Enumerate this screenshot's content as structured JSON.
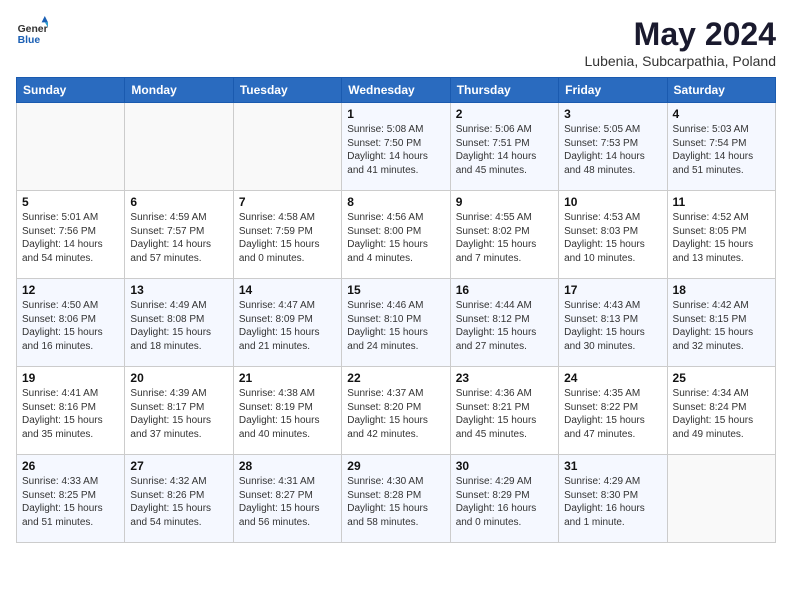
{
  "header": {
    "logo_general": "General",
    "logo_blue": "Blue",
    "title": "May 2024",
    "location": "Lubenia, Subcarpathia, Poland"
  },
  "weekdays": [
    "Sunday",
    "Monday",
    "Tuesday",
    "Wednesday",
    "Thursday",
    "Friday",
    "Saturday"
  ],
  "weeks": [
    [
      {
        "day": "",
        "info": ""
      },
      {
        "day": "",
        "info": ""
      },
      {
        "day": "",
        "info": ""
      },
      {
        "day": "1",
        "info": "Sunrise: 5:08 AM\nSunset: 7:50 PM\nDaylight: 14 hours\nand 41 minutes."
      },
      {
        "day": "2",
        "info": "Sunrise: 5:06 AM\nSunset: 7:51 PM\nDaylight: 14 hours\nand 45 minutes."
      },
      {
        "day": "3",
        "info": "Sunrise: 5:05 AM\nSunset: 7:53 PM\nDaylight: 14 hours\nand 48 minutes."
      },
      {
        "day": "4",
        "info": "Sunrise: 5:03 AM\nSunset: 7:54 PM\nDaylight: 14 hours\nand 51 minutes."
      }
    ],
    [
      {
        "day": "5",
        "info": "Sunrise: 5:01 AM\nSunset: 7:56 PM\nDaylight: 14 hours\nand 54 minutes."
      },
      {
        "day": "6",
        "info": "Sunrise: 4:59 AM\nSunset: 7:57 PM\nDaylight: 14 hours\nand 57 minutes."
      },
      {
        "day": "7",
        "info": "Sunrise: 4:58 AM\nSunset: 7:59 PM\nDaylight: 15 hours\nand 0 minutes."
      },
      {
        "day": "8",
        "info": "Sunrise: 4:56 AM\nSunset: 8:00 PM\nDaylight: 15 hours\nand 4 minutes."
      },
      {
        "day": "9",
        "info": "Sunrise: 4:55 AM\nSunset: 8:02 PM\nDaylight: 15 hours\nand 7 minutes."
      },
      {
        "day": "10",
        "info": "Sunrise: 4:53 AM\nSunset: 8:03 PM\nDaylight: 15 hours\nand 10 minutes."
      },
      {
        "day": "11",
        "info": "Sunrise: 4:52 AM\nSunset: 8:05 PM\nDaylight: 15 hours\nand 13 minutes."
      }
    ],
    [
      {
        "day": "12",
        "info": "Sunrise: 4:50 AM\nSunset: 8:06 PM\nDaylight: 15 hours\nand 16 minutes."
      },
      {
        "day": "13",
        "info": "Sunrise: 4:49 AM\nSunset: 8:08 PM\nDaylight: 15 hours\nand 18 minutes."
      },
      {
        "day": "14",
        "info": "Sunrise: 4:47 AM\nSunset: 8:09 PM\nDaylight: 15 hours\nand 21 minutes."
      },
      {
        "day": "15",
        "info": "Sunrise: 4:46 AM\nSunset: 8:10 PM\nDaylight: 15 hours\nand 24 minutes."
      },
      {
        "day": "16",
        "info": "Sunrise: 4:44 AM\nSunset: 8:12 PM\nDaylight: 15 hours\nand 27 minutes."
      },
      {
        "day": "17",
        "info": "Sunrise: 4:43 AM\nSunset: 8:13 PM\nDaylight: 15 hours\nand 30 minutes."
      },
      {
        "day": "18",
        "info": "Sunrise: 4:42 AM\nSunset: 8:15 PM\nDaylight: 15 hours\nand 32 minutes."
      }
    ],
    [
      {
        "day": "19",
        "info": "Sunrise: 4:41 AM\nSunset: 8:16 PM\nDaylight: 15 hours\nand 35 minutes."
      },
      {
        "day": "20",
        "info": "Sunrise: 4:39 AM\nSunset: 8:17 PM\nDaylight: 15 hours\nand 37 minutes."
      },
      {
        "day": "21",
        "info": "Sunrise: 4:38 AM\nSunset: 8:19 PM\nDaylight: 15 hours\nand 40 minutes."
      },
      {
        "day": "22",
        "info": "Sunrise: 4:37 AM\nSunset: 8:20 PM\nDaylight: 15 hours\nand 42 minutes."
      },
      {
        "day": "23",
        "info": "Sunrise: 4:36 AM\nSunset: 8:21 PM\nDaylight: 15 hours\nand 45 minutes."
      },
      {
        "day": "24",
        "info": "Sunrise: 4:35 AM\nSunset: 8:22 PM\nDaylight: 15 hours\nand 47 minutes."
      },
      {
        "day": "25",
        "info": "Sunrise: 4:34 AM\nSunset: 8:24 PM\nDaylight: 15 hours\nand 49 minutes."
      }
    ],
    [
      {
        "day": "26",
        "info": "Sunrise: 4:33 AM\nSunset: 8:25 PM\nDaylight: 15 hours\nand 51 minutes."
      },
      {
        "day": "27",
        "info": "Sunrise: 4:32 AM\nSunset: 8:26 PM\nDaylight: 15 hours\nand 54 minutes."
      },
      {
        "day": "28",
        "info": "Sunrise: 4:31 AM\nSunset: 8:27 PM\nDaylight: 15 hours\nand 56 minutes."
      },
      {
        "day": "29",
        "info": "Sunrise: 4:30 AM\nSunset: 8:28 PM\nDaylight: 15 hours\nand 58 minutes."
      },
      {
        "day": "30",
        "info": "Sunrise: 4:29 AM\nSunset: 8:29 PM\nDaylight: 16 hours\nand 0 minutes."
      },
      {
        "day": "31",
        "info": "Sunrise: 4:29 AM\nSunset: 8:30 PM\nDaylight: 16 hours\nand 1 minute."
      },
      {
        "day": "",
        "info": ""
      }
    ]
  ]
}
